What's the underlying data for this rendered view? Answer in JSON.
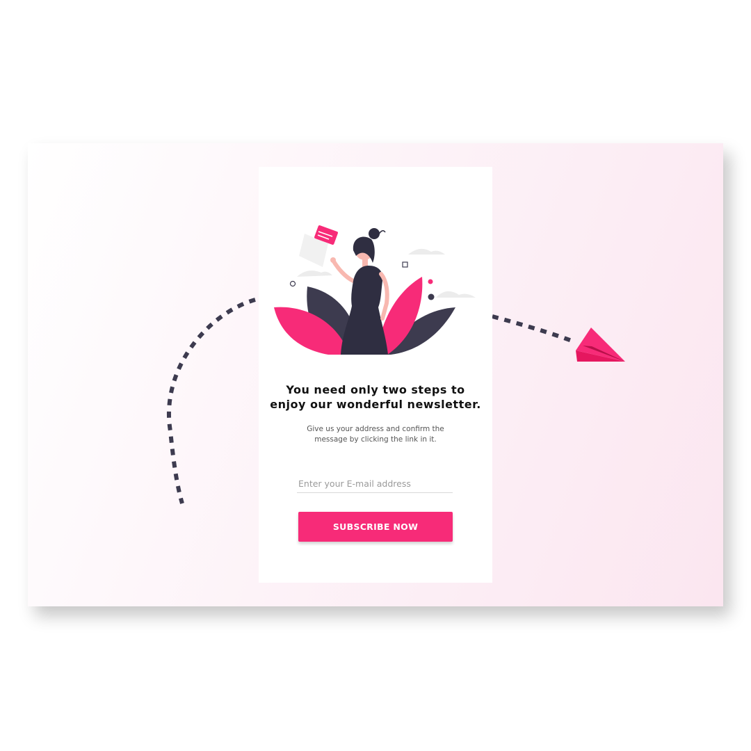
{
  "colors": {
    "accent": "#f72b78",
    "dark": "#3d3b4f",
    "panel_gradient_end": "#fbe6f0"
  },
  "card": {
    "headline_line1": "You need only two steps to",
    "headline_line2": "enjoy our wonderful newsletter.",
    "subtext_line1": "Give us your address and confirm the",
    "subtext_line2": "message by clicking the link in it.",
    "email_placeholder": "Enter your E-mail address",
    "email_value": "",
    "subscribe_label": "SUBSCRIBE NOW"
  },
  "icons": {
    "illustration": "woman-holding-envelope-illustration",
    "paper_plane": "paper-plane-icon",
    "dotted_path": "dashed-arrow-path"
  }
}
